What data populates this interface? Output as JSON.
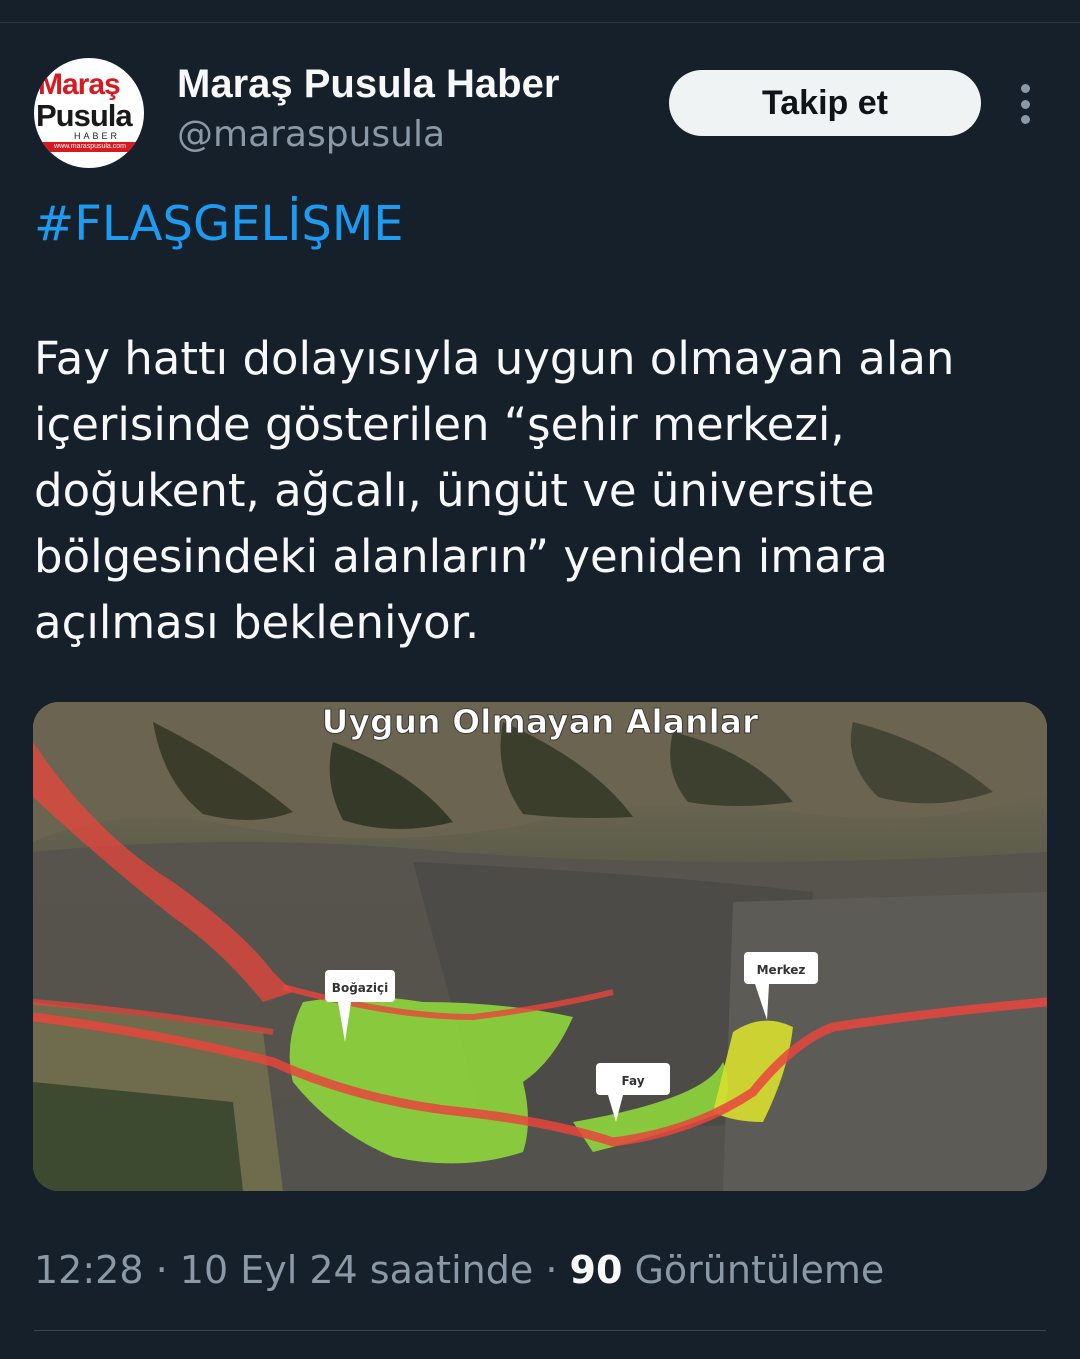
{
  "author": {
    "display_name": "Maraş Pusula Haber",
    "handle": "@maraspusula",
    "avatar_logo": {
      "line1": "Maraş",
      "line2": "Pusula",
      "line3": "HABER",
      "line4": "www.maraspusula.com"
    }
  },
  "follow_label": "Takip et",
  "hashtag": "#FLAŞGELİŞME",
  "tweet_text": "Fay hattı dolayısıyla uygun olmayan alan\niçerisinde gösterilen “şehir merkezi,\ndoğukent, ağcalı, üngüt ve üniversite\nbölgesindeki alanların” yeniden imara\naçılması bekleniyor.",
  "media": {
    "title": "Uygun Olmayan Alanlar",
    "labels": {
      "bogazici": "Boğaziçi",
      "fay": "Fay",
      "merkez": "Merkez"
    }
  },
  "meta": {
    "time": "12:28",
    "separator": "·",
    "date": "10 Eyl 24 saatinde",
    "views_count": "90",
    "views_label": "Görüntüleme"
  },
  "colors": {
    "background": "#15202b",
    "link": "#1d9bf0",
    "secondary": "#8b98a5",
    "fault": "#e8453c",
    "unsuitable_area": "#8ed63c",
    "merkez_area": "#d8df2e"
  }
}
